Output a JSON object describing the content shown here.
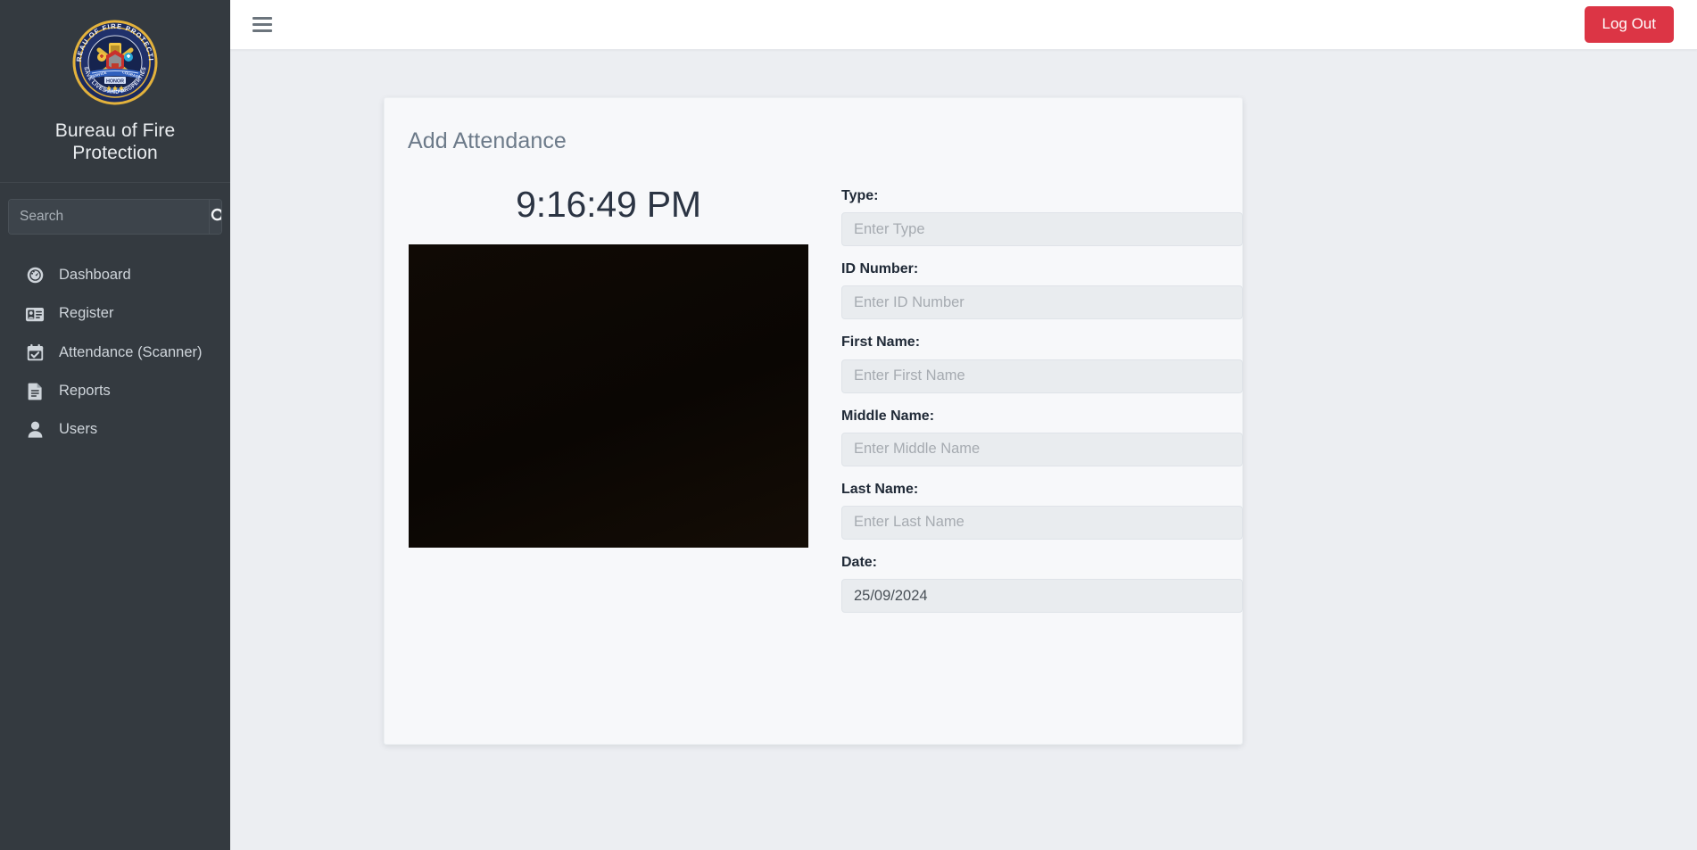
{
  "sidebar": {
    "logo_icon": "bfp-seal-logo",
    "brand_title": "Bureau of Fire Protection",
    "search": {
      "placeholder": "Search",
      "value": "",
      "button_icon": "search-icon"
    },
    "items": [
      {
        "label": "Dashboard",
        "icon": "dashboard-gauge-icon"
      },
      {
        "label": "Register",
        "icon": "id-card-icon"
      },
      {
        "label": "Attendance (Scanner)",
        "icon": "calendar-check-icon"
      },
      {
        "label": "Reports",
        "icon": "document-lines-icon"
      },
      {
        "label": "Users",
        "icon": "user-icon"
      }
    ]
  },
  "topbar": {
    "menu_icon": "hamburger-menu-icon",
    "logout_label": "Log Out",
    "logout_color": "#dc3545"
  },
  "card": {
    "title": "Add Attendance",
    "clock": "9:16:49 PM",
    "camera_label": "camera-feed",
    "fields": [
      {
        "label": "Type:",
        "placeholder": "Enter Type",
        "value": ""
      },
      {
        "label": "ID Number:",
        "placeholder": "Enter ID Number",
        "value": ""
      },
      {
        "label": "First Name:",
        "placeholder": "Enter First Name",
        "value": ""
      },
      {
        "label": "Middle Name:",
        "placeholder": "Enter Middle Name",
        "value": ""
      },
      {
        "label": "Last Name:",
        "placeholder": "Enter Last Name",
        "value": ""
      },
      {
        "label": "Date:",
        "placeholder": "",
        "value": "25/09/2024"
      }
    ]
  },
  "colors": {
    "sidebar_bg": "#343a40",
    "page_bg": "#eceef2",
    "card_bg": "#f7f8fa",
    "accent_danger": "#dc3545",
    "input_bg": "#e9ecef"
  }
}
